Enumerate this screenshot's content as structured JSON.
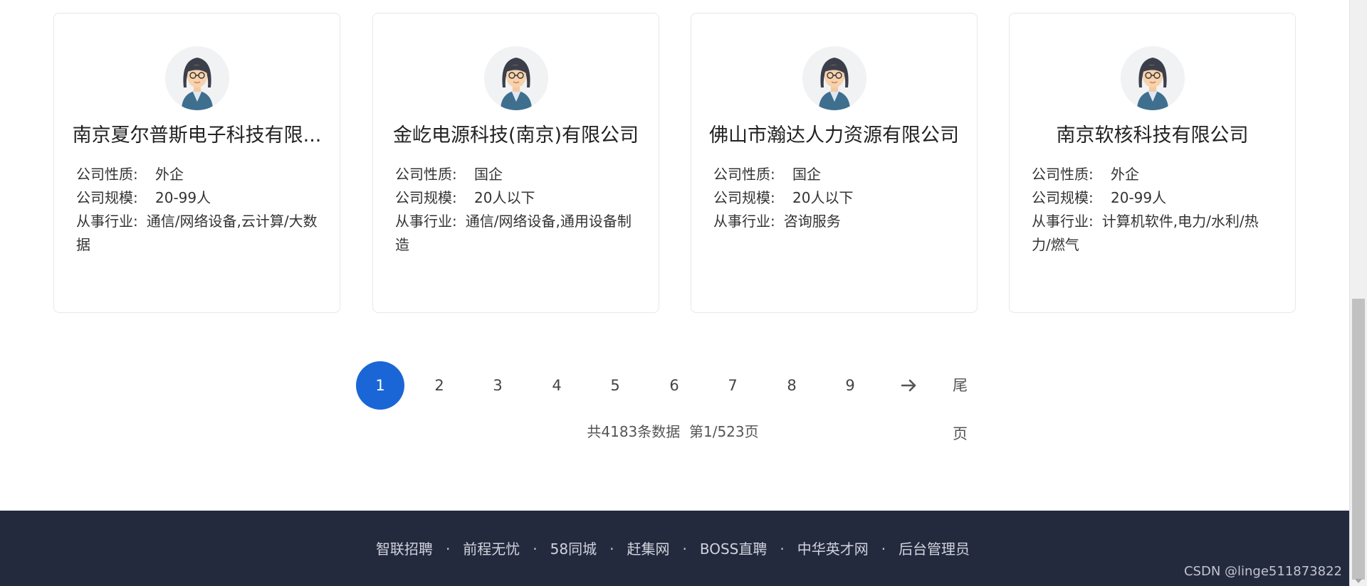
{
  "companies": [
    {
      "name": "南京夏尔普斯电子科技有限...",
      "nature_label": "公司性质:",
      "nature": "外企",
      "size_label": "公司规模:",
      "size": "20-99人",
      "industry_label": "从事行业:",
      "industry": "通信/网络设备,云计算/大数据"
    },
    {
      "name": "金屹电源科技(南京)有限公司",
      "nature_label": "公司性质:",
      "nature": "国企",
      "size_label": "公司规模:",
      "size": "20人以下",
      "industry_label": "从事行业:",
      "industry": "通信/网络设备,通用设备制造"
    },
    {
      "name": "佛山市瀚达人力资源有限公司",
      "nature_label": "公司性质:",
      "nature": "国企",
      "size_label": "公司规模:",
      "size": "20人以下",
      "industry_label": "从事行业:",
      "industry": "咨询服务"
    },
    {
      "name": "南京软核科技有限公司",
      "nature_label": "公司性质:",
      "nature": "外企",
      "size_label": "公司规模:",
      "size": "20-99人",
      "industry_label": "从事行业:",
      "industry": "计算机软件,电力/水利/热力/燃气"
    }
  ],
  "pagination": {
    "pages": [
      "1",
      "2",
      "3",
      "4",
      "5",
      "6",
      "7",
      "8",
      "9"
    ],
    "current": "1",
    "next_icon": "arrow-right-icon",
    "last_label": "尾页",
    "stats": "共4183条数据  第1/523页"
  },
  "footer": {
    "links": [
      "智联招聘",
      "前程无忧",
      "58同城",
      "赶集网",
      "BOSS直聘",
      "中华英才网",
      "后台管理员"
    ],
    "separator": "·",
    "watermark": "CSDN @linge511873822"
  },
  "colors": {
    "accent": "#1a66d6",
    "footer_bg": "#242a3e"
  }
}
